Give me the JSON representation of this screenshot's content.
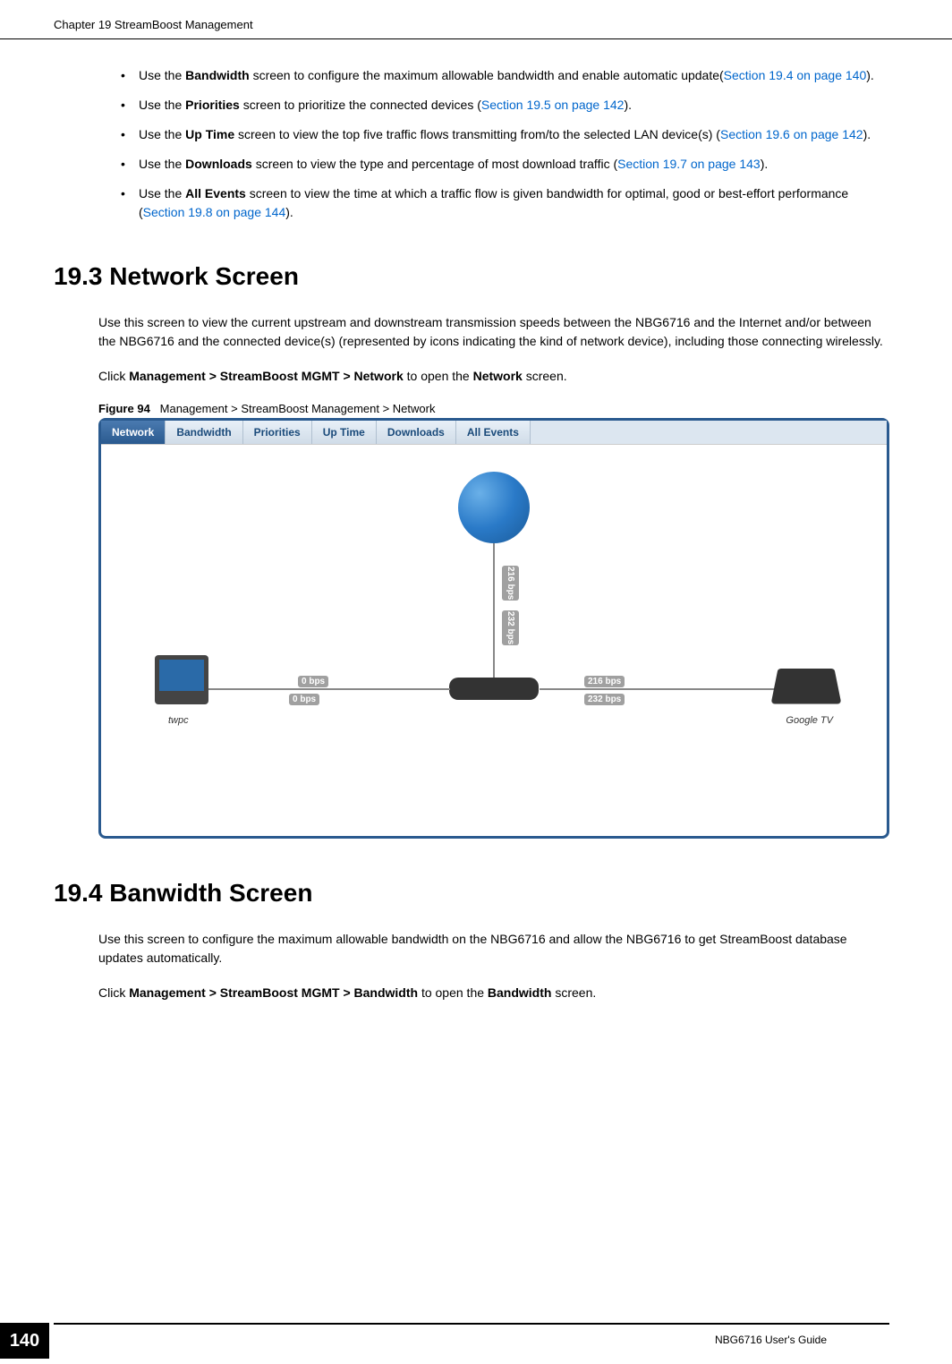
{
  "header": {
    "chapter_title": "Chapter 19 StreamBoost Management"
  },
  "bullets": [
    {
      "prefix": "Use the ",
      "bold": "Bandwidth",
      "mid": " screen to configure the maximum allowable bandwidth and enable automatic update(",
      "link": "Section 19.4 on page 140",
      "suffix": ")."
    },
    {
      "prefix": "Use the ",
      "bold": "Priorities",
      "mid": " screen to prioritize the connected devices (",
      "link": "Section 19.5 on page 142",
      "suffix": ")."
    },
    {
      "prefix": "Use the ",
      "bold": "Up Time",
      "mid": " screen to view the top five traffic flows transmitting from/to the selected LAN device(s) (",
      "link": "Section 19.6 on page 142",
      "suffix": ")."
    },
    {
      "prefix": "Use the ",
      "bold": "Downloads",
      "mid": " screen to view the type and percentage of most download traffic (",
      "link": "Section 19.7 on page 143",
      "suffix": ")."
    },
    {
      "prefix": "Use the ",
      "bold": "All Events",
      "mid": " screen to view the time at which a traffic flow is given bandwidth for optimal, good or best-effort performance (",
      "link": "Section 19.8 on page 144",
      "suffix": ")."
    }
  ],
  "section_193": {
    "heading": "19.3  Network Screen",
    "p1": "Use this screen to view the current upstream and downstream transmission speeds between the NBG6716 and the Internet and/or between the NBG6716 and the connected device(s) (represented by icons indicating the kind of network device), including those connecting wirelessly.",
    "p2_prefix": "Click ",
    "p2_bold1": "Management > StreamBoost MGMT > Network",
    "p2_mid": " to open the ",
    "p2_bold2": "Network",
    "p2_suffix": " screen.",
    "figure_label": "Figure 94",
    "figure_caption": "Management > StreamBoost Management > Network"
  },
  "figure": {
    "tabs": [
      "Network",
      "Bandwidth",
      "Priorities",
      "Up Time",
      "Downloads",
      "All Events"
    ],
    "speed_up": "216 bps",
    "speed_down": "232 bps",
    "speed_left1": "0 bps",
    "speed_left2": "0 bps",
    "speed_right1": "216 bps",
    "speed_right2": "232 bps",
    "device_pc": "twpc",
    "device_tablet": "Google TV"
  },
  "section_194": {
    "heading": "19.4  Banwidth Screen",
    "p1": "Use this screen to configure the maximum allowable bandwidth on the NBG6716 and allow the NBG6716 to get StreamBoost database updates automatically.",
    "p2_prefix": "Click ",
    "p2_bold1": "Management > StreamBoost MGMT > Bandwidth",
    "p2_mid": " to open the ",
    "p2_bold2": "Bandwidth",
    "p2_suffix": " screen."
  },
  "footer": {
    "page_number": "140",
    "guide": "NBG6716 User's Guide"
  }
}
